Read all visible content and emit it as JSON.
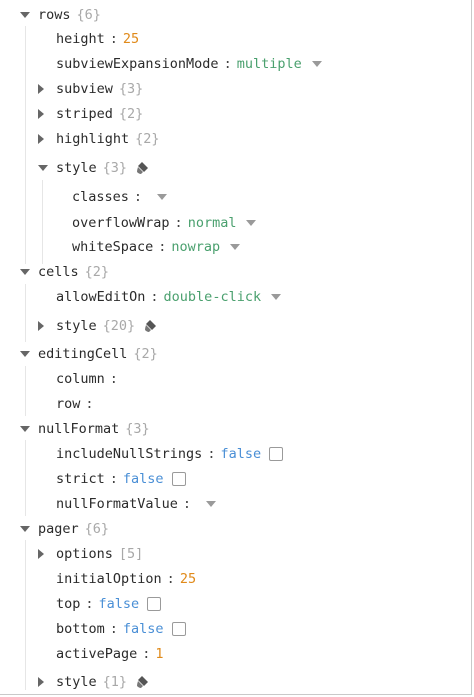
{
  "tree": {
    "rows": {
      "key": "rows",
      "count": "{6}",
      "height": {
        "key": "height",
        "value": "25"
      },
      "subviewExpansionMode": {
        "key": "subviewExpansionMode",
        "value": "multiple"
      },
      "subview": {
        "key": "subview",
        "count": "{3}"
      },
      "striped": {
        "key": "striped",
        "count": "{2}"
      },
      "highlight": {
        "key": "highlight",
        "count": "{2}"
      },
      "style": {
        "key": "style",
        "count": "{3}",
        "classes": {
          "key": "classes",
          "value": ""
        },
        "overflowWrap": {
          "key": "overflowWrap",
          "value": "normal"
        },
        "whiteSpace": {
          "key": "whiteSpace",
          "value": "nowrap"
        }
      }
    },
    "cells": {
      "key": "cells",
      "count": "{2}",
      "allowEditOn": {
        "key": "allowEditOn",
        "value": "double-click"
      },
      "style": {
        "key": "style",
        "count": "{20}"
      }
    },
    "editingCell": {
      "key": "editingCell",
      "count": "{2}",
      "column": {
        "key": "column",
        "value": ""
      },
      "row": {
        "key": "row",
        "value": ""
      }
    },
    "nullFormat": {
      "key": "nullFormat",
      "count": "{3}",
      "includeNullStrings": {
        "key": "includeNullStrings",
        "value": "false"
      },
      "strict": {
        "key": "strict",
        "value": "false"
      },
      "nullFormatValue": {
        "key": "nullFormatValue",
        "value": ""
      }
    },
    "pager": {
      "key": "pager",
      "count": "{6}",
      "options": {
        "key": "options",
        "count": "[5]"
      },
      "initialOption": {
        "key": "initialOption",
        "value": "25"
      },
      "top": {
        "key": "top",
        "value": "false"
      },
      "bottom": {
        "key": "bottom",
        "value": "false"
      },
      "activePage": {
        "key": "activePage",
        "value": "1"
      },
      "style": {
        "key": "style",
        "count": "{1}"
      }
    }
  },
  "colors": {
    "number": "#e08a1a",
    "string": "#4aa06e",
    "boolean": "#4a8fd6",
    "count": "#a8a8a8"
  },
  "icons": {
    "expanded": "triangle-down-icon",
    "collapsed": "triangle-right-icon",
    "style": "brush-icon",
    "dropdown": "chevron-down-icon",
    "checkbox": "checkbox-icon"
  }
}
